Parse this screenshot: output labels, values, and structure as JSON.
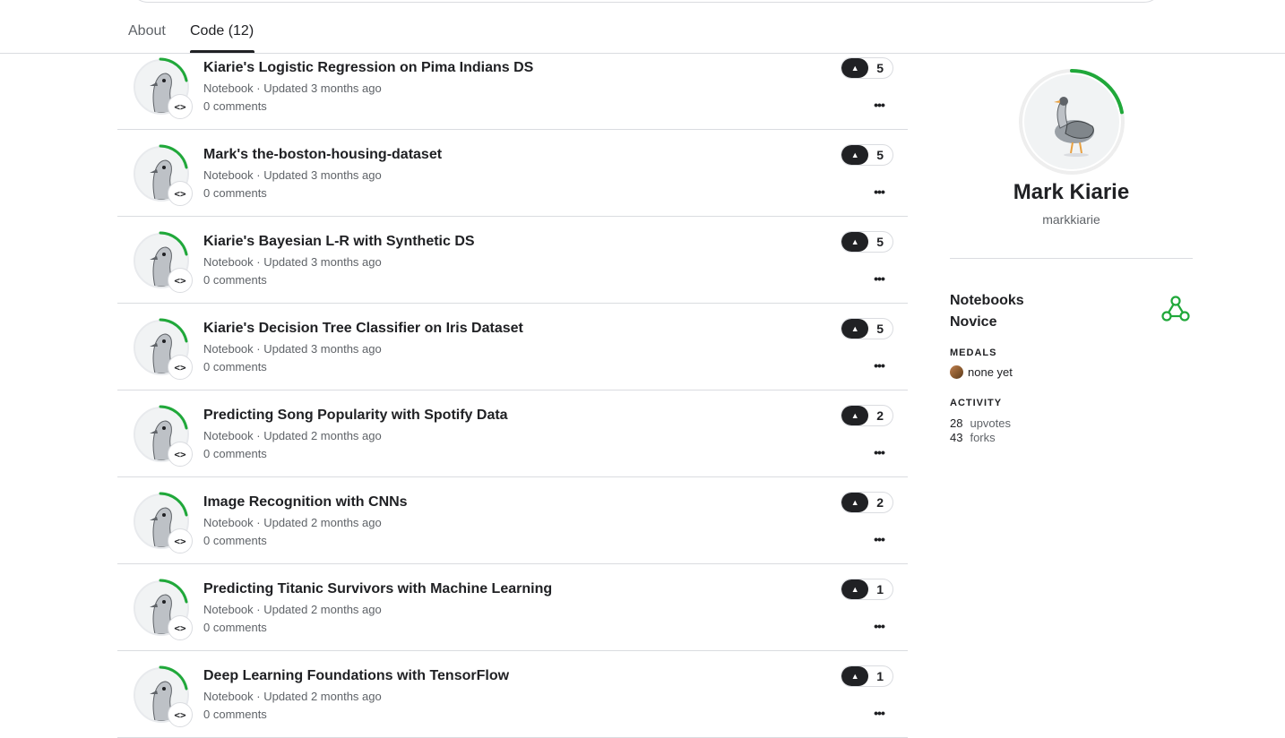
{
  "tabs": [
    {
      "label": "About",
      "active": false
    },
    {
      "label": "Code (12)",
      "active": true
    }
  ],
  "notebooks": [
    {
      "title": "Kiarie's Logistic Regression on Pima Indians DS",
      "meta": "Notebook · Updated 3 months ago",
      "comments": "0 comments",
      "votes": "5"
    },
    {
      "title": "Mark's the-boston-housing-dataset",
      "meta": "Notebook · Updated 3 months ago",
      "comments": "0 comments",
      "votes": "5"
    },
    {
      "title": "Kiarie's Bayesian L-R with Synthetic DS",
      "meta": "Notebook · Updated 3 months ago",
      "comments": "0 comments",
      "votes": "5"
    },
    {
      "title": "Kiarie's Decision Tree Classifier on Iris Dataset",
      "meta": "Notebook · Updated 3 months ago",
      "comments": "0 comments",
      "votes": "5"
    },
    {
      "title": "Predicting Song Popularity with Spotify Data",
      "meta": "Notebook · Updated 2 months ago",
      "comments": "0 comments",
      "votes": "2"
    },
    {
      "title": "Image Recognition with CNNs",
      "meta": "Notebook · Updated 2 months ago",
      "comments": "0 comments",
      "votes": "2"
    },
    {
      "title": "Predicting Titanic Survivors with Machine Learning",
      "meta": "Notebook · Updated 2 months ago",
      "comments": "0 comments",
      "votes": "1"
    },
    {
      "title": "Deep Learning Foundations with TensorFlow",
      "meta": "Notebook · Updated 2 months ago",
      "comments": "0 comments",
      "votes": "1"
    }
  ],
  "icons": {
    "code": "<>",
    "more": "•••",
    "upvote": "▲"
  },
  "profile": {
    "name": "Mark Kiarie",
    "handle": "markkiarie",
    "tier_line1": "Notebooks",
    "tier_line2": "Novice",
    "medals_label": "MEDALS",
    "medals_value": "none yet",
    "activity_label": "ACTIVITY",
    "upvotes_count": "28",
    "upvotes_label": "upvotes",
    "forks_count": "43",
    "forks_label": "forks",
    "progress_fraction": 0.22
  },
  "colors": {
    "accent_green": "#20a83a",
    "text": "#202124",
    "muted": "#5f6368",
    "divider": "#dadce0"
  }
}
